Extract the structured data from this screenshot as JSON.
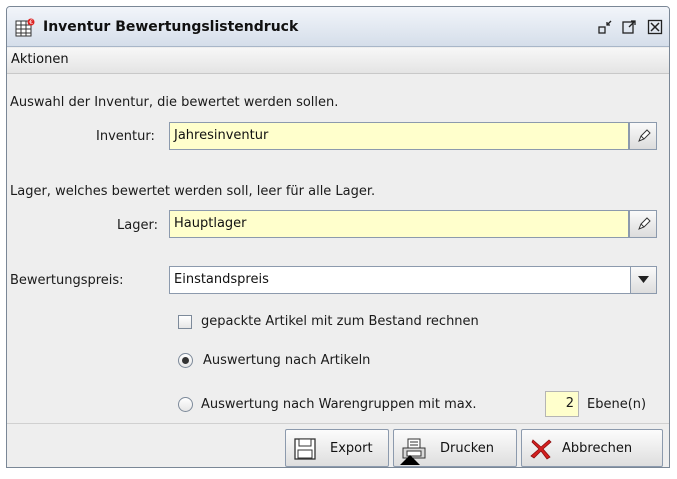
{
  "window": {
    "title": "Inventur Bewertungslistendruck",
    "icon": "inventory-grid-icon",
    "controls": [
      "minimize-icon",
      "maximize-icon",
      "close-icon"
    ]
  },
  "menubar": {
    "items": [
      "Aktionen"
    ]
  },
  "form": {
    "inventur_hint": "Auswahl der Inventur, die bewertet werden sollen.",
    "inventur_label": "Inventur:",
    "inventur_value": "Jahresinventur",
    "lager_hint": "Lager, welches bewertet werden soll, leer für alle Lager.",
    "lager_label": "Lager:",
    "lager_value": "Hauptlager",
    "price_label": "Bewertungspreis:",
    "price_value": "Einstandspreis",
    "checkbox_label": "gepackte Artikel mit zum Bestand rechnen",
    "checkbox_checked": false,
    "radio_articles_label": "Auswertung nach Artikeln",
    "radio_articles_selected": true,
    "radio_groups_label": "Auswertung nach Warengruppen mit max.",
    "radio_groups_selected": false,
    "levels_value": "2",
    "levels_unit": "Ebene(n)"
  },
  "footer": {
    "export_label": "Export",
    "print_label": "Drucken",
    "cancel_label": "Abbrechen"
  },
  "colors": {
    "field_bg": "#ffffcc",
    "title_gradient_top": "#f2f5fa",
    "title_gradient_bottom": "#d5deea",
    "cancel_red": "#d42020"
  }
}
